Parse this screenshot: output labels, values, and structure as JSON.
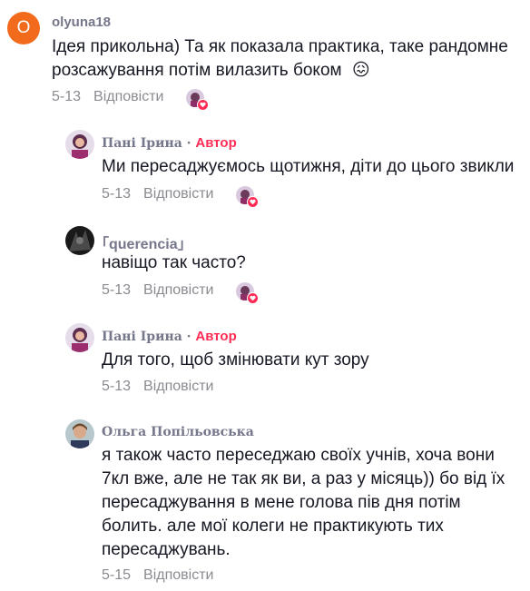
{
  "comments": [
    {
      "avatar_letter": "O",
      "username": "olyuna18",
      "text_line1": "Ідея прикольна) Та як показала практика, таке рандомне",
      "text_line2": "розсажування потім вилазить боком",
      "emoji": "😖",
      "date": "5-13",
      "reply_label": "Відповісти"
    },
    {
      "username": "Пані Ірина",
      "separator": "·",
      "author_label": "Автор",
      "text": "Ми пересаджуємось щотижня, діти до цього звикли",
      "date": "5-13",
      "reply_label": "Відповісти"
    },
    {
      "username": "｢querencia｣",
      "text": "навіщо так часто?",
      "date": "5-13",
      "reply_label": "Відповісти"
    },
    {
      "username": "Пані Ірина",
      "separator": "·",
      "author_label": "Автор",
      "text": "Для того, щоб змінювати кут зору",
      "date": "5-13",
      "reply_label": "Відповісти"
    },
    {
      "username": "Ольга Попільовська",
      "text_line1": "я також часто переседжаю своїх учнів, хоча вони",
      "text_line2": "7кл вже, але не так як ви, а раз у місяць)) бо від їх",
      "text_line3": "пересаджування в мене голова пів дня потім",
      "text_line4": "болить. але мої колеги не практикують тих",
      "text_line5": "пересаджувань.",
      "date": "5-15",
      "reply_label": "Відповісти"
    }
  ],
  "colors": {
    "accent": "#fe2c55",
    "orange_avatar": "#f26b1d",
    "muted": "#8a8b91"
  }
}
